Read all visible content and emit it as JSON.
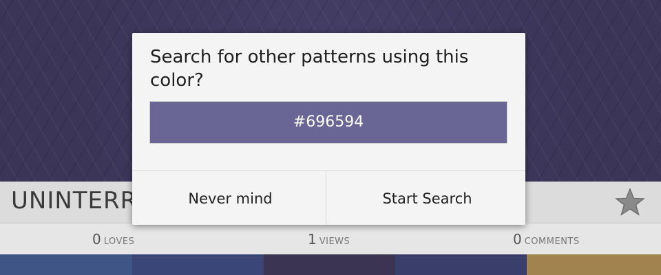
{
  "background": {
    "pattern_title": "UNINTERRU",
    "favorite_icon": "star-icon",
    "stats": {
      "loves_count": "0",
      "loves_label": "LOVES",
      "views_count": "1",
      "views_label": "VIEWS",
      "comments_count": "0",
      "comments_label": "COMMENTS"
    },
    "palette": [
      "#3f5585",
      "#3a4677",
      "#3b3452",
      "#3a3e6a",
      "#a0834f"
    ]
  },
  "dialog": {
    "title": "Search for other patterns using this color?",
    "color_hex": "#696594",
    "cancel_label": "Never mind",
    "confirm_label": "Start Search"
  }
}
